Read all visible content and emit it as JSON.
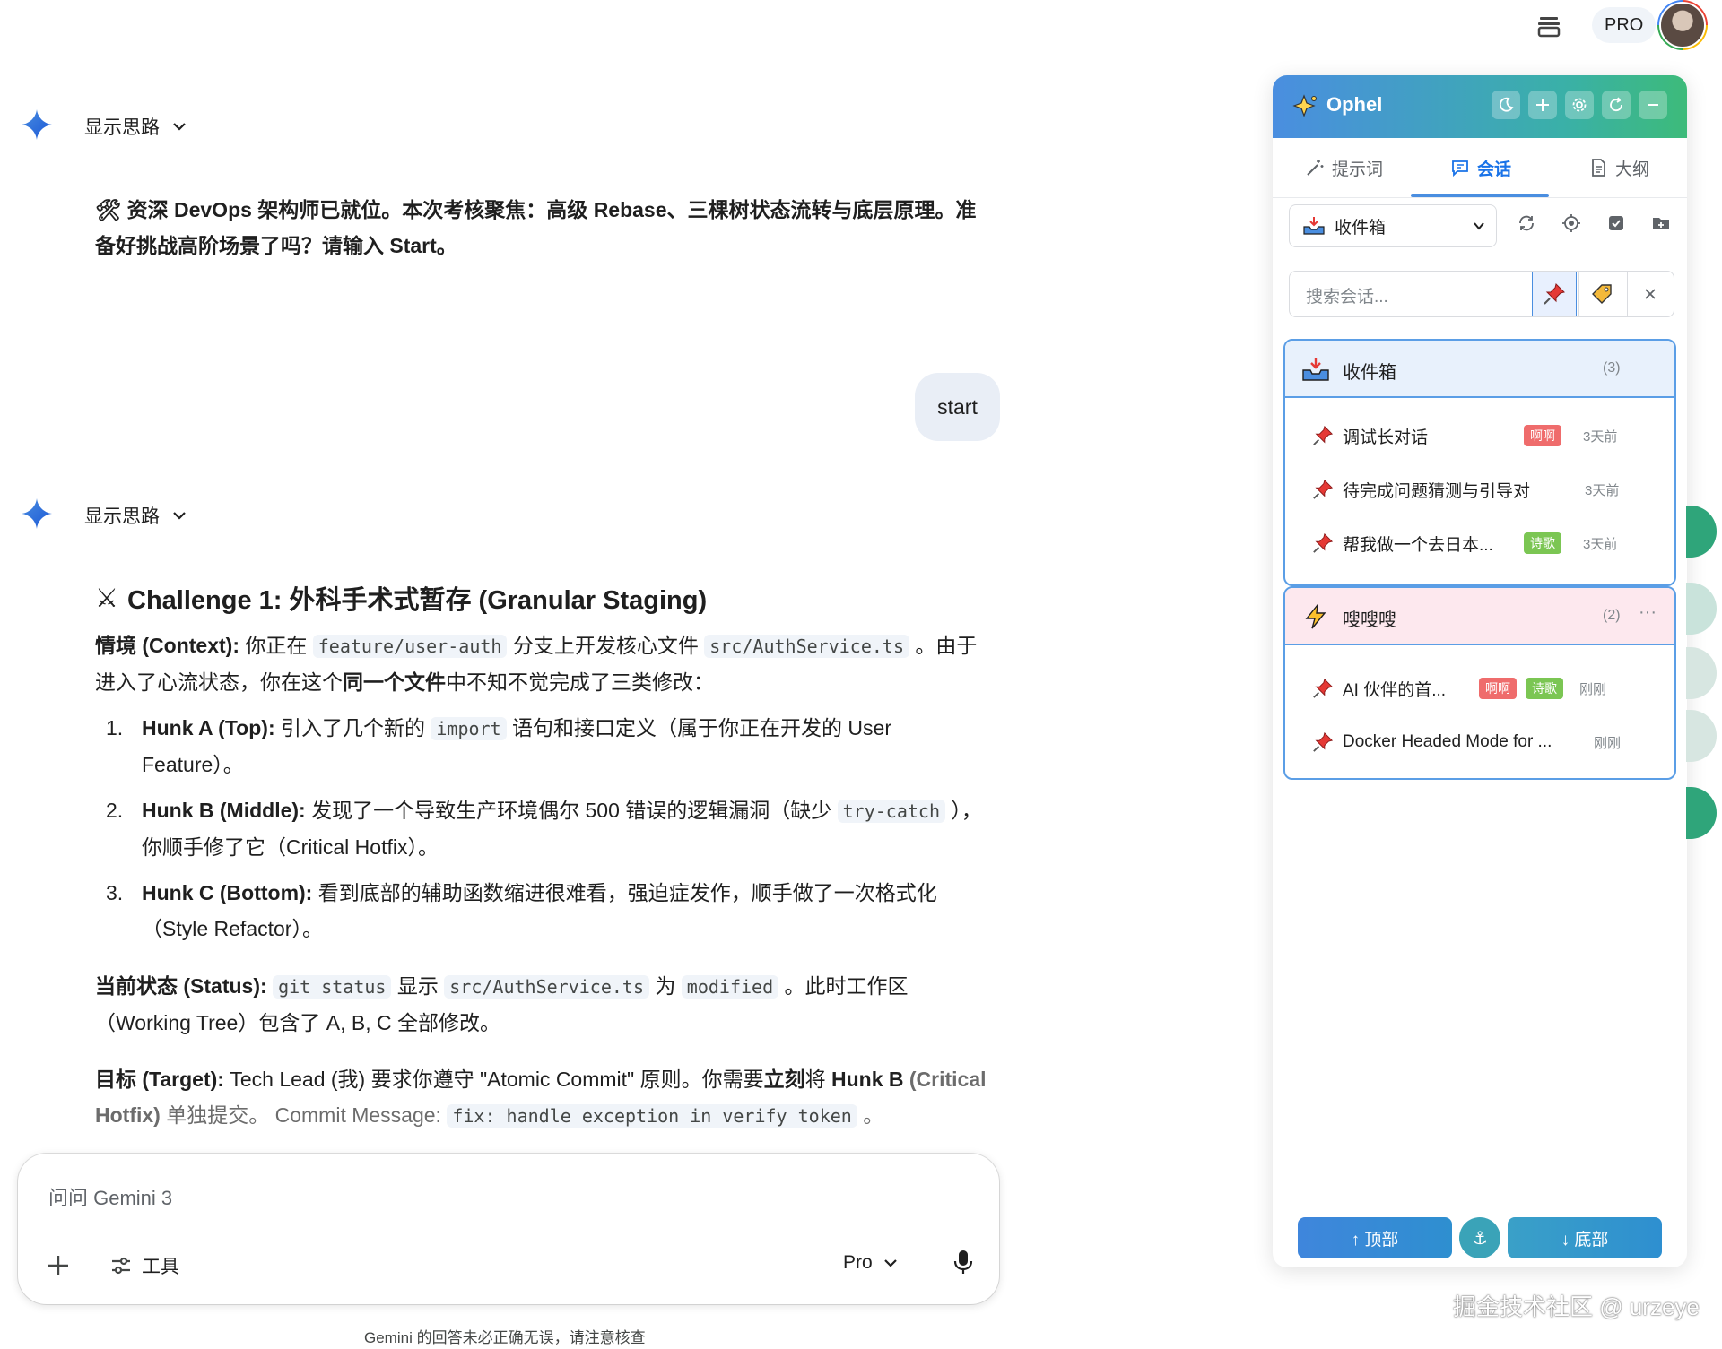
{
  "topbar": {
    "pro_label": "PRO",
    "icons": [
      "layers-icon",
      "avatar"
    ]
  },
  "chat": {
    "think_label_1": "显示思路",
    "intro": {
      "emoji_icon": "tools-icon",
      "text": "资深 DevOps 架构师已就位。本次考核聚焦：高级 Rebase、三棵树状态流转与底层原理。准备好挑战高阶场景了吗？请输入 Start。"
    },
    "user_message": "start",
    "think_label_2": "显示思路",
    "challenge_title": "Challenge 1: 外科手术式暂存 (Granular Staging)",
    "context": {
      "label": "情境 (Context):",
      "t1": " 你正在 ",
      "code1": "feature/user-auth",
      "t2": " 分支上开发核心文件 ",
      "code2": "src/AuthService.ts",
      "t3": " 。由于进入了心流状态，你在这个",
      "bold1": "同一个文件",
      "t4": "中不知不觉完成了三类修改："
    },
    "hunks": [
      {
        "num": "1.",
        "label": "Hunk A (Top):",
        "t1": " 引入了几个新的 ",
        "code": "import",
        "t2": " 语句和接口定义（属于你正在开发的 User Feature）。"
      },
      {
        "num": "2.",
        "label": "Hunk B (Middle):",
        "t1": " 发现了一个导致生产环境偶尔 500 错误的逻辑漏洞（缺少 ",
        "code": "try-catch",
        "t2": " ），你顺手修了它（Critical Hotfix）。"
      },
      {
        "num": "3.",
        "label": "Hunk C (Bottom):",
        "t1": " 看到底部的辅助函数缩进很难看，强迫症发作，顺手做了一次格式化（Style Refactor）。",
        "code": "",
        "t2": ""
      }
    ],
    "status": {
      "label": "当前状态 (Status):",
      "code1": "git status",
      "t1": " 显示 ",
      "code2": "src/AuthService.ts",
      "t2": " 为 ",
      "code3": "modified",
      "t3": " 。此时工作区（Working Tree）包含了 A, B, C 全部修改。"
    },
    "target": {
      "label": "目标 (Target):",
      "t1": " Tech Lead (我) 要求你遵守 \"Atomic Commit\" 原则。你需要",
      "bold1": "立刻",
      "t2": "将 ",
      "bold2": "Hunk B",
      "bold3": "(Critical Hotfix)",
      "t3": " 单独提交。 Commit Message: ",
      "code1": "fix: handle exception in verify token",
      "t4": " 。"
    }
  },
  "input": {
    "placeholder": "问问 Gemini 3",
    "tools_label": "工具",
    "model_label": "Pro",
    "disclaimer": "Gemini 的回答未必正确无误，请注意核查"
  },
  "panel": {
    "title": "Ophel",
    "header_buttons": [
      "moon-icon",
      "plus-icon",
      "gear-icon",
      "refresh-icon",
      "minimize-icon"
    ],
    "tabs": [
      {
        "label": "提示词",
        "icon": "wand-icon"
      },
      {
        "label": "会话",
        "icon": "chat-icon"
      },
      {
        "label": "大纲",
        "icon": "document-icon"
      }
    ],
    "folder_select": "收件箱",
    "search_placeholder": "搜索会话...",
    "groups": [
      {
        "name": "收件箱",
        "count": "(3)",
        "items": [
          {
            "title": "调试长对话",
            "tags": [
              {
                "text": "啊啊",
                "color": "#ef6c6c"
              }
            ],
            "time": "3天前"
          },
          {
            "title": "待完成问题猜测与引导对",
            "tags": [],
            "time": "3天前"
          },
          {
            "title": "帮我做一个去日本...",
            "tags": [
              {
                "text": "诗歌",
                "color": "#7bc653"
              }
            ],
            "time": "3天前"
          }
        ]
      },
      {
        "name": "嗖嗖嗖",
        "count": "(2)",
        "more": "···",
        "items": [
          {
            "title": "AI 伙伴的首...",
            "tags": [
              {
                "text": "啊啊",
                "color": "#ef6c6c"
              },
              {
                "text": "诗歌",
                "color": "#7bc653"
              }
            ],
            "time": "刚刚"
          },
          {
            "title": "Docker Headed Mode for ...",
            "tags": [],
            "time": "刚刚"
          }
        ]
      }
    ],
    "btn_top": "↑ 顶部",
    "btn_anchor": "⚓",
    "btn_bottom": "↓ 底部"
  },
  "watermark": "掘金技术社区 @ urzeye",
  "colors": {
    "accent_blue": "#4a8ee0",
    "accent_green": "#3dbb7a",
    "tag_red": "#ef6c6c",
    "tag_green": "#7bc653"
  }
}
